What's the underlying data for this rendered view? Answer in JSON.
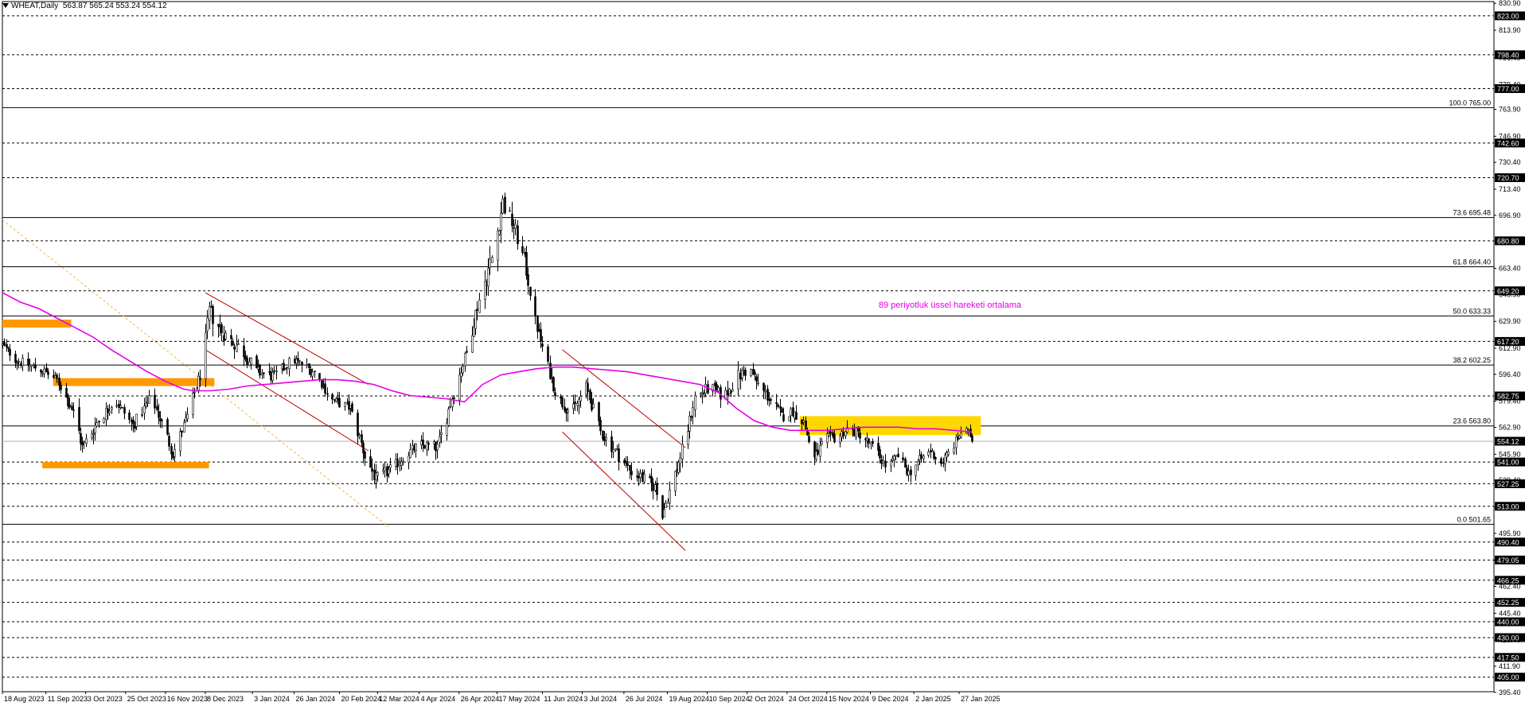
{
  "header": {
    "symbol": "WHEAT,Daily",
    "ohlc": "563.87 565.24 553.24 554.12"
  },
  "chart_data": {
    "type": "candlestick",
    "symbol": "WHEAT",
    "timeframe": "Daily",
    "last_price": 554.12,
    "ylim": [
      395.8,
      832
    ],
    "price_ticks": [
      "830.90",
      "813.90",
      "796.40",
      "779.40",
      "763.90",
      "746.90",
      "730.40",
      "713.40",
      "696.90",
      "680.40",
      "663.40",
      "646.90",
      "629.90",
      "612.90",
      "596.40",
      "579.40",
      "562.90",
      "545.90",
      "529.40",
      "512.40",
      "495.90",
      "478.90",
      "462.40",
      "445.40",
      "428.40",
      "411.90",
      "395.40"
    ],
    "date_ticks": [
      {
        "label": "18 Aug 2023",
        "day": 0
      },
      {
        "label": "11 Sep 2023",
        "day": 24
      },
      {
        "label": "3 Oct 2023",
        "day": 46
      },
      {
        "label": "25 Oct 2023",
        "day": 68
      },
      {
        "label": "16 Nov 2023",
        "day": 90
      },
      {
        "label": "8 Dec 2023",
        "day": 112
      },
      {
        "label": "3 Jan 2024",
        "day": 138
      },
      {
        "label": "26 Jan 2024",
        "day": 161
      },
      {
        "label": "20 Feb 2024",
        "day": 186
      },
      {
        "label": "12 Mar 2024",
        "day": 207
      },
      {
        "label": "4 Apr 2024",
        "day": 230
      },
      {
        "label": "26 Apr 2024",
        "day": 252
      },
      {
        "label": "17 May 2024",
        "day": 273
      },
      {
        "label": "11 Jun 2024",
        "day": 298
      },
      {
        "label": "3 Jul 2024",
        "day": 320
      },
      {
        "label": "26 Jul 2024",
        "day": 343
      },
      {
        "label": "19 Aug 2024",
        "day": 367
      },
      {
        "label": "10 Sep 2024",
        "day": 389
      },
      {
        "label": "2 Oct 2024",
        "day": 411
      },
      {
        "label": "24 Oct 2024",
        "day": 433
      },
      {
        "label": "15 Nov 2024",
        "day": 455
      },
      {
        "label": "9 Dec 2024",
        "day": 479
      },
      {
        "label": "2 Jan 2025",
        "day": 503
      },
      {
        "label": "27 Jan 2025",
        "day": 528
      }
    ],
    "last_day": 535,
    "dashed_levels": [
      {
        "price": 823.0,
        "label": "823.00"
      },
      {
        "price": 798.4,
        "label": "798.40"
      },
      {
        "price": 777.0,
        "label": "777.00"
      },
      {
        "price": 742.6,
        "label": "742.60"
      },
      {
        "price": 720.7,
        "label": "720.70"
      },
      {
        "price": 680.8,
        "label": "680.80"
      },
      {
        "price": 649.2,
        "label": "649.20"
      },
      {
        "price": 617.2,
        "label": "617.20"
      },
      {
        "price": 582.75,
        "label": "582.75"
      },
      {
        "price": 541.0,
        "label": "541.00"
      },
      {
        "price": 527.25,
        "label": "527.25"
      },
      {
        "price": 513.0,
        "label": "513.00"
      },
      {
        "price": 490.4,
        "label": "490.40"
      },
      {
        "price": 479.05,
        "label": "479.05"
      },
      {
        "price": 466.25,
        "label": "466.25"
      },
      {
        "price": 452.25,
        "label": "452.25"
      },
      {
        "price": 440.0,
        "label": "440.00"
      },
      {
        "price": 430.0,
        "label": "430.00"
      },
      {
        "price": 417.5,
        "label": "417.50"
      },
      {
        "price": 405.0,
        "label": "405.00"
      }
    ],
    "fib_levels": [
      {
        "price": 765.0,
        "label": "100.0 765.00"
      },
      {
        "price": 695.48,
        "label": "73.6 695.48"
      },
      {
        "price": 664.4,
        "label": "61.8 664.40"
      },
      {
        "price": 633.33,
        "label": "50.0 633.33"
      },
      {
        "price": 602.25,
        "label": "38.2 602.25"
      },
      {
        "price": 563.8,
        "label": "23.6 563.80"
      },
      {
        "price": 501.65,
        "label": "0.0 501.65"
      }
    ],
    "ema_label": "89 periyotluk üssel hareketi ortalama",
    "ema_period": 89,
    "colors": {
      "candle": "#000000",
      "ema": "#e600e6",
      "orange_zone": "#ff9900",
      "gold_zone": "#ffd700",
      "channel": "#c00000",
      "trend_dotted": "#f5b041",
      "label_bg": "#000000",
      "label_text": "#ffffff",
      "ema_text": "#e600e6"
    },
    "anchors": [
      [
        0,
        615,
        3
      ],
      [
        8,
        605,
        4
      ],
      [
        20,
        600,
        4
      ],
      [
        30,
        593,
        3
      ],
      [
        40,
        570,
        5
      ],
      [
        44,
        550,
        6
      ],
      [
        52,
        566,
        5
      ],
      [
        62,
        580,
        4
      ],
      [
        72,
        564,
        5
      ],
      [
        82,
        582,
        4
      ],
      [
        90,
        560,
        5
      ],
      [
        94,
        546,
        5
      ],
      [
        102,
        570,
        4
      ],
      [
        110,
        600,
        5
      ],
      [
        114,
        636,
        7
      ],
      [
        122,
        622,
        6
      ],
      [
        132,
        612,
        6
      ],
      [
        140,
        598,
        5
      ],
      [
        150,
        595,
        5
      ],
      [
        160,
        606,
        4
      ],
      [
        172,
        598,
        4
      ],
      [
        182,
        580,
        4
      ],
      [
        192,
        575,
        4
      ],
      [
        200,
        545,
        6
      ],
      [
        206,
        530,
        5
      ],
      [
        214,
        536,
        5
      ],
      [
        222,
        545,
        4
      ],
      [
        230,
        552,
        4
      ],
      [
        240,
        550,
        5
      ],
      [
        248,
        582,
        6
      ],
      [
        256,
        610,
        5
      ],
      [
        262,
        640,
        6
      ],
      [
        270,
        670,
        8
      ],
      [
        276,
        705,
        8
      ],
      [
        282,
        690,
        7
      ],
      [
        288,
        668,
        6
      ],
      [
        294,
        630,
        5
      ],
      [
        300,
        605,
        5
      ],
      [
        306,
        582,
        5
      ],
      [
        314,
        572,
        5
      ],
      [
        322,
        588,
        5
      ],
      [
        330,
        560,
        5
      ],
      [
        338,
        548,
        5
      ],
      [
        346,
        536,
        5
      ],
      [
        354,
        530,
        5
      ],
      [
        360,
        525,
        5
      ],
      [
        364,
        508,
        4
      ],
      [
        370,
        530,
        5
      ],
      [
        376,
        552,
        5
      ],
      [
        382,
        582,
        5
      ],
      [
        390,
        588,
        5
      ],
      [
        398,
        582,
        5
      ],
      [
        406,
        595,
        6
      ],
      [
        412,
        600,
        5
      ],
      [
        418,
        588,
        5
      ],
      [
        424,
        580,
        5
      ],
      [
        430,
        570,
        5
      ],
      [
        436,
        573,
        4
      ],
      [
        442,
        566,
        4
      ],
      [
        448,
        543,
        5
      ],
      [
        454,
        556,
        4
      ],
      [
        460,
        556,
        4
      ],
      [
        466,
        562,
        4
      ],
      [
        474,
        558,
        4
      ],
      [
        482,
        548,
        4
      ],
      [
        488,
        537,
        4
      ],
      [
        494,
        545,
        4
      ],
      [
        500,
        534,
        4
      ],
      [
        506,
        542,
        4
      ],
      [
        512,
        548,
        4
      ],
      [
        518,
        540,
        4
      ],
      [
        524,
        550,
        4
      ],
      [
        530,
        562,
        4
      ],
      [
        534,
        558,
        3
      ],
      [
        535,
        554.12,
        3
      ]
    ],
    "ema_points": [
      [
        0,
        648
      ],
      [
        10,
        642
      ],
      [
        20,
        638
      ],
      [
        30,
        632
      ],
      [
        40,
        626
      ],
      [
        50,
        620
      ],
      [
        60,
        612
      ],
      [
        70,
        605
      ],
      [
        80,
        598
      ],
      [
        90,
        592
      ],
      [
        100,
        587
      ],
      [
        106,
        586
      ],
      [
        115,
        586
      ],
      [
        125,
        587
      ],
      [
        135,
        589
      ],
      [
        145,
        590
      ],
      [
        155,
        591
      ],
      [
        165,
        592
      ],
      [
        175,
        593
      ],
      [
        185,
        593
      ],
      [
        195,
        592
      ],
      [
        205,
        590
      ],
      [
        215,
        586
      ],
      [
        225,
        583
      ],
      [
        235,
        582
      ],
      [
        245,
        581
      ],
      [
        255,
        579
      ],
      [
        265,
        590
      ],
      [
        275,
        596
      ],
      [
        285,
        598
      ],
      [
        295,
        600
      ],
      [
        305,
        601
      ],
      [
        315,
        601
      ],
      [
        325,
        600
      ],
      [
        335,
        599
      ],
      [
        345,
        598
      ],
      [
        355,
        596
      ],
      [
        365,
        594
      ],
      [
        375,
        592
      ],
      [
        385,
        590
      ],
      [
        395,
        585
      ],
      [
        405,
        575
      ],
      [
        415,
        567
      ],
      [
        425,
        563
      ],
      [
        435,
        561
      ],
      [
        445,
        561
      ],
      [
        455,
        561
      ],
      [
        465,
        562
      ],
      [
        475,
        563
      ],
      [
        485,
        563
      ],
      [
        495,
        563
      ],
      [
        505,
        562
      ],
      [
        515,
        562
      ],
      [
        525,
        561
      ],
      [
        535,
        560
      ]
    ],
    "orange_zones": [
      {
        "d1": 0,
        "d2": 38,
        "y1": 631,
        "y2": 626
      },
      {
        "d1": 28,
        "d2": 117,
        "y1": 594,
        "y2": 589
      },
      {
        "d1": 22,
        "d2": 114,
        "y1": 541,
        "y2": 537
      }
    ],
    "gold_zone": {
      "d1": 440,
      "d2": 540,
      "y1": 570,
      "y2": 558
    },
    "channels": [
      [
        [
          112,
          648
        ],
        [
          202,
          590
        ]
      ],
      [
        [
          112,
          612
        ],
        [
          202,
          548
        ]
      ],
      [
        [
          309,
          612
        ],
        [
          377,
          550
        ]
      ],
      [
        [
          309,
          560
        ],
        [
          377,
          485
        ]
      ]
    ],
    "dotted_trend": [
      [
        0,
        694
      ],
      [
        213,
        500
      ]
    ]
  }
}
